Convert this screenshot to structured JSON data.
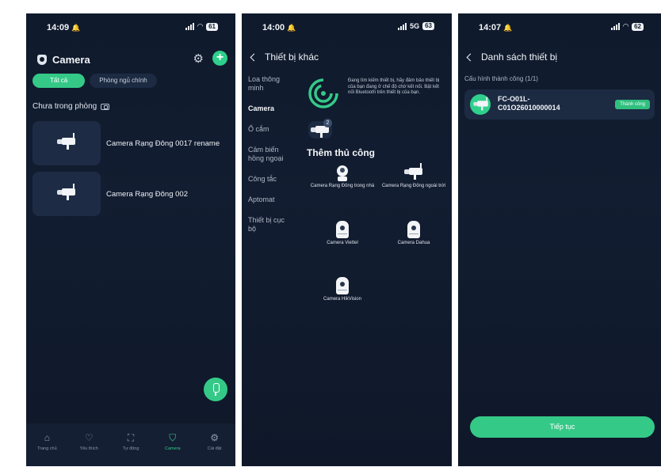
{
  "phone1": {
    "time": "14:09",
    "battery": "61",
    "title": "Camera",
    "tabs": [
      {
        "label": "Tất cả",
        "active": true
      },
      {
        "label": "Phòng ngủ chính",
        "active": false
      }
    ],
    "section": "Chưa trong phòng",
    "cameras": [
      {
        "name": "Camera Rạng Đông 0017 rename"
      },
      {
        "name": "Camera Rạng Đông 002"
      }
    ],
    "nav": [
      {
        "label": "Trang chủ",
        "icon": "home-icon",
        "glyph": "⌂",
        "active": false
      },
      {
        "label": "Yêu thích",
        "icon": "heart-icon",
        "glyph": "♡",
        "active": false
      },
      {
        "label": "Tự động",
        "icon": "automation-icon",
        "glyph": "⛶",
        "active": false
      },
      {
        "label": "Camera",
        "icon": "camera-shield-icon",
        "glyph": "⛉",
        "active": true
      },
      {
        "label": "Cài đặt",
        "icon": "gear-icon",
        "glyph": "⚙",
        "active": false
      }
    ]
  },
  "phone2": {
    "time": "14:00",
    "network": "5G",
    "battery": "63",
    "title": "Thiết bị khác",
    "categories": [
      {
        "label": "Loa thông minh",
        "active": false
      },
      {
        "label": "Camera",
        "active": true
      },
      {
        "label": "Ổ cắm",
        "active": false
      },
      {
        "label": "Cảm biến hồng ngoại",
        "active": false
      },
      {
        "label": "Công tắc",
        "active": false
      },
      {
        "label": "Aptomat",
        "active": false
      },
      {
        "label": "Thiết bị cục bộ",
        "active": false
      }
    ],
    "scan_text": "Đang tìm kiếm thiết bị, hãy đảm bảo thiết bị của bạn đang ở chế độ chờ kết nối. Bật kết nối Bluetooth trên thiết bị của bạn.",
    "found_count": "2",
    "manual_title": "Thêm thủ công",
    "manual_items": [
      {
        "label": "Camera Rạng Đông trong nhà"
      },
      {
        "label": "Camera Rạng Đông ngoài trời"
      },
      {
        "label": "Camera Viettel"
      },
      {
        "label": "Camera Dahua"
      },
      {
        "label": "Camera HikVision"
      }
    ]
  },
  "phone3": {
    "time": "14:07",
    "battery": "62",
    "title": "Danh sách thiết bị",
    "success_label": "Cấu hình thành công (1/1)",
    "device_name": "FC-O01L-C01O26010000014",
    "device_status": "Thành công",
    "continue_label": "Tiếp tục"
  },
  "colors": {
    "accent": "#35c988",
    "background": "#0f1a2c",
    "card": "#1c2a42"
  }
}
